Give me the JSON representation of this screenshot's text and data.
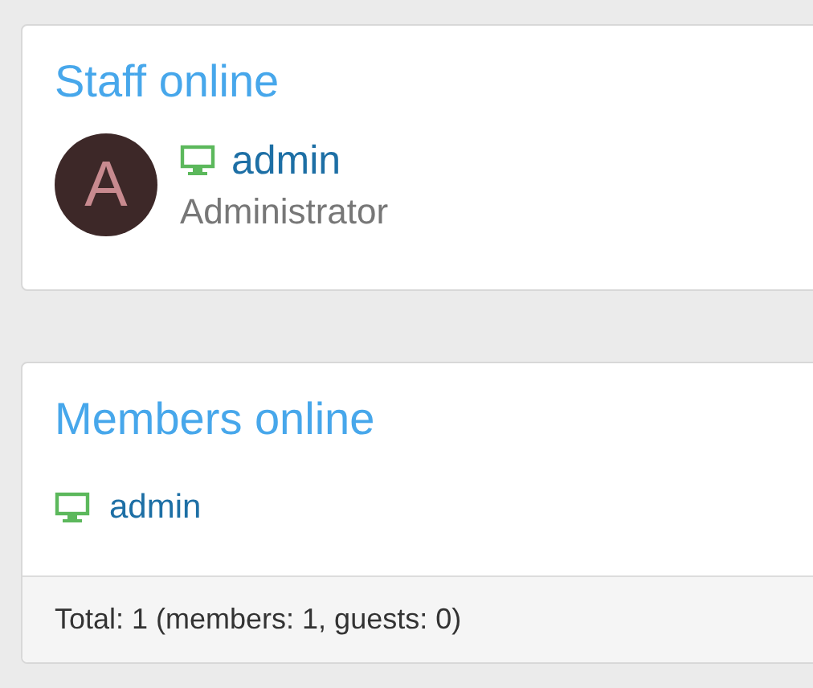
{
  "staff_online": {
    "title": "Staff online",
    "members": [
      {
        "avatar_letter": "A",
        "name": "admin",
        "role": "Administrator"
      }
    ]
  },
  "members_online": {
    "title": "Members online",
    "members": [
      {
        "name": "admin"
      }
    ],
    "footer": "Total: 1 (members: 1, guests: 0)"
  }
}
